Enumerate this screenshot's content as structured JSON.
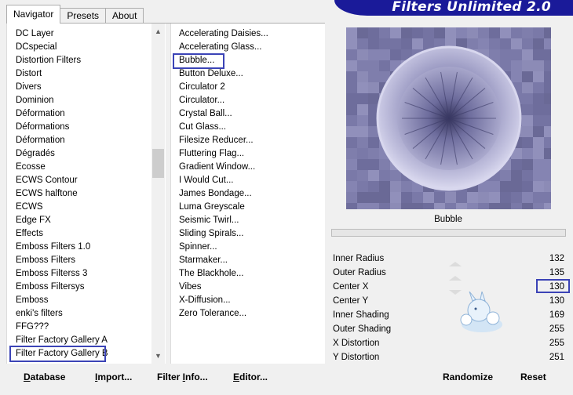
{
  "app": {
    "title": "Filters Unlimited 2.0"
  },
  "tabs": [
    {
      "label": "Navigator",
      "active": true
    },
    {
      "label": "Presets",
      "active": false
    },
    {
      "label": "About",
      "active": false
    }
  ],
  "categories": {
    "items": [
      "DC Layer",
      "DCspecial",
      "Distortion Filters",
      "Distort",
      "Divers",
      "Dominion",
      "Déformation",
      "Déformations",
      "Déformation",
      "Dégradés",
      "Ecosse",
      "ECWS Contour",
      "ECWS halftone",
      "ECWS",
      "Edge FX",
      "Effects",
      "Emboss Filters 1.0",
      "Emboss Filters",
      "Emboss Filterss 3",
      "Emboss Filtersys",
      "Emboss",
      "enki's filters",
      "FFG???",
      "Filter Factory Gallery A",
      "Filter Factory Gallery B"
    ],
    "selected_index": 24
  },
  "filters": {
    "items": [
      "Accelerating Daisies...",
      "Accelerating Glass...",
      "Bubble...",
      "Button Deluxe...",
      "Circulator 2",
      "Circulator...",
      "Crystal Ball...",
      "Cut Glass...",
      "Filesize Reducer...",
      "Fluttering Flag...",
      "Gradient Window...",
      "I Would Cut...",
      "James Bondage...",
      "Luma Greyscale",
      "Seismic Twirl...",
      "Sliding Spirals...",
      "Spinner...",
      "Starmaker...",
      "The Blackhole...",
      "Vibes",
      "X-Diffusion...",
      "Zero Tolerance..."
    ],
    "selected_index": 2
  },
  "preview": {
    "filter_name": "Bubble"
  },
  "params": [
    {
      "label": "Inner Radius",
      "value": "132"
    },
    {
      "label": "Outer Radius",
      "value": "135"
    },
    {
      "label": "Center X",
      "value": "130",
      "highlight": true
    },
    {
      "label": "Center Y",
      "value": "130"
    },
    {
      "label": "Inner Shading",
      "value": "169"
    },
    {
      "label": "Outer Shading",
      "value": "255"
    },
    {
      "label": "X Distortion",
      "value": "255"
    },
    {
      "label": "Y Distortion",
      "value": "251"
    }
  ],
  "buttons": {
    "database": {
      "underline": "D",
      "rest": "atabase"
    },
    "import": {
      "underline": "I",
      "rest": "mport..."
    },
    "filter_info": {
      "before": "Filter ",
      "underline": "I",
      "rest": "nfo..."
    },
    "editor": {
      "underline": "E",
      "rest": "ditor..."
    },
    "randomize": "Randomize",
    "reset": "Reset"
  },
  "colors": {
    "banner": "#1a1a99",
    "highlight_box": "#3b43b6",
    "preview_bg": "#7b7aa6"
  },
  "icons": {
    "scroll_up": "▲",
    "scroll_down": "▼"
  }
}
